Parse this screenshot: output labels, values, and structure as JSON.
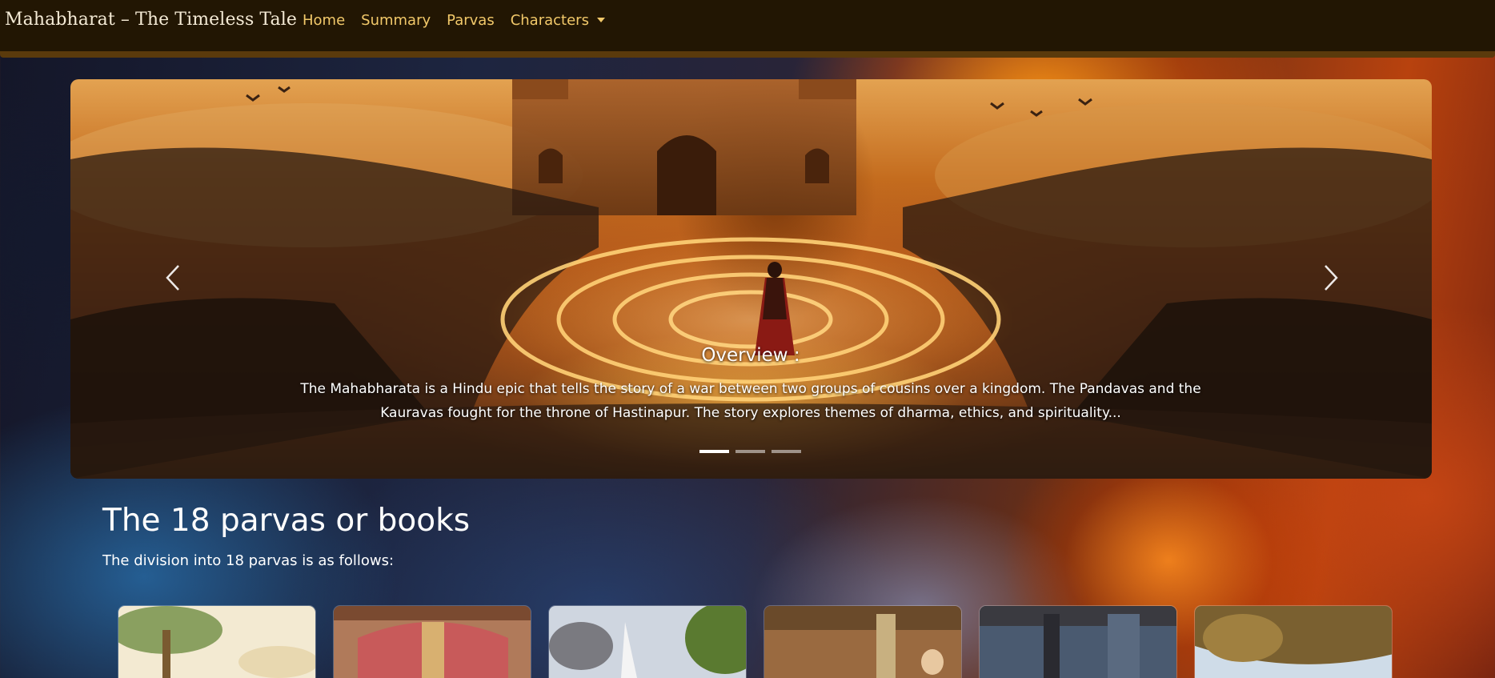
{
  "navbar": {
    "brand": "Mahabharat – The Timeless Tale",
    "links": [
      {
        "label": "Home"
      },
      {
        "label": "Summary"
      },
      {
        "label": "Parvas"
      },
      {
        "label": "Characters",
        "dropdown": true
      }
    ]
  },
  "carousel": {
    "slide_count": 3,
    "active_index": 0,
    "caption": {
      "title": "Overview :",
      "text": "The Mahabharata is a Hindu epic that tells the story of a war between two groups of cousins over a kingdom. The Pandavas and the Kauravas fought for the throne of Hastinapur. The story explores themes of dharma, ethics, and spirituality..."
    },
    "prev_icon": "chevron-left-icon",
    "next_icon": "chevron-right-icon"
  },
  "parvas_section": {
    "title": "The 18 parvas or books",
    "subtitle": "The division into 18 parvas is as follows:"
  },
  "theme": {
    "navbar_bg": "#221603",
    "nav_link_color": "#f2c96a",
    "brand_color": "#f4ead5"
  }
}
